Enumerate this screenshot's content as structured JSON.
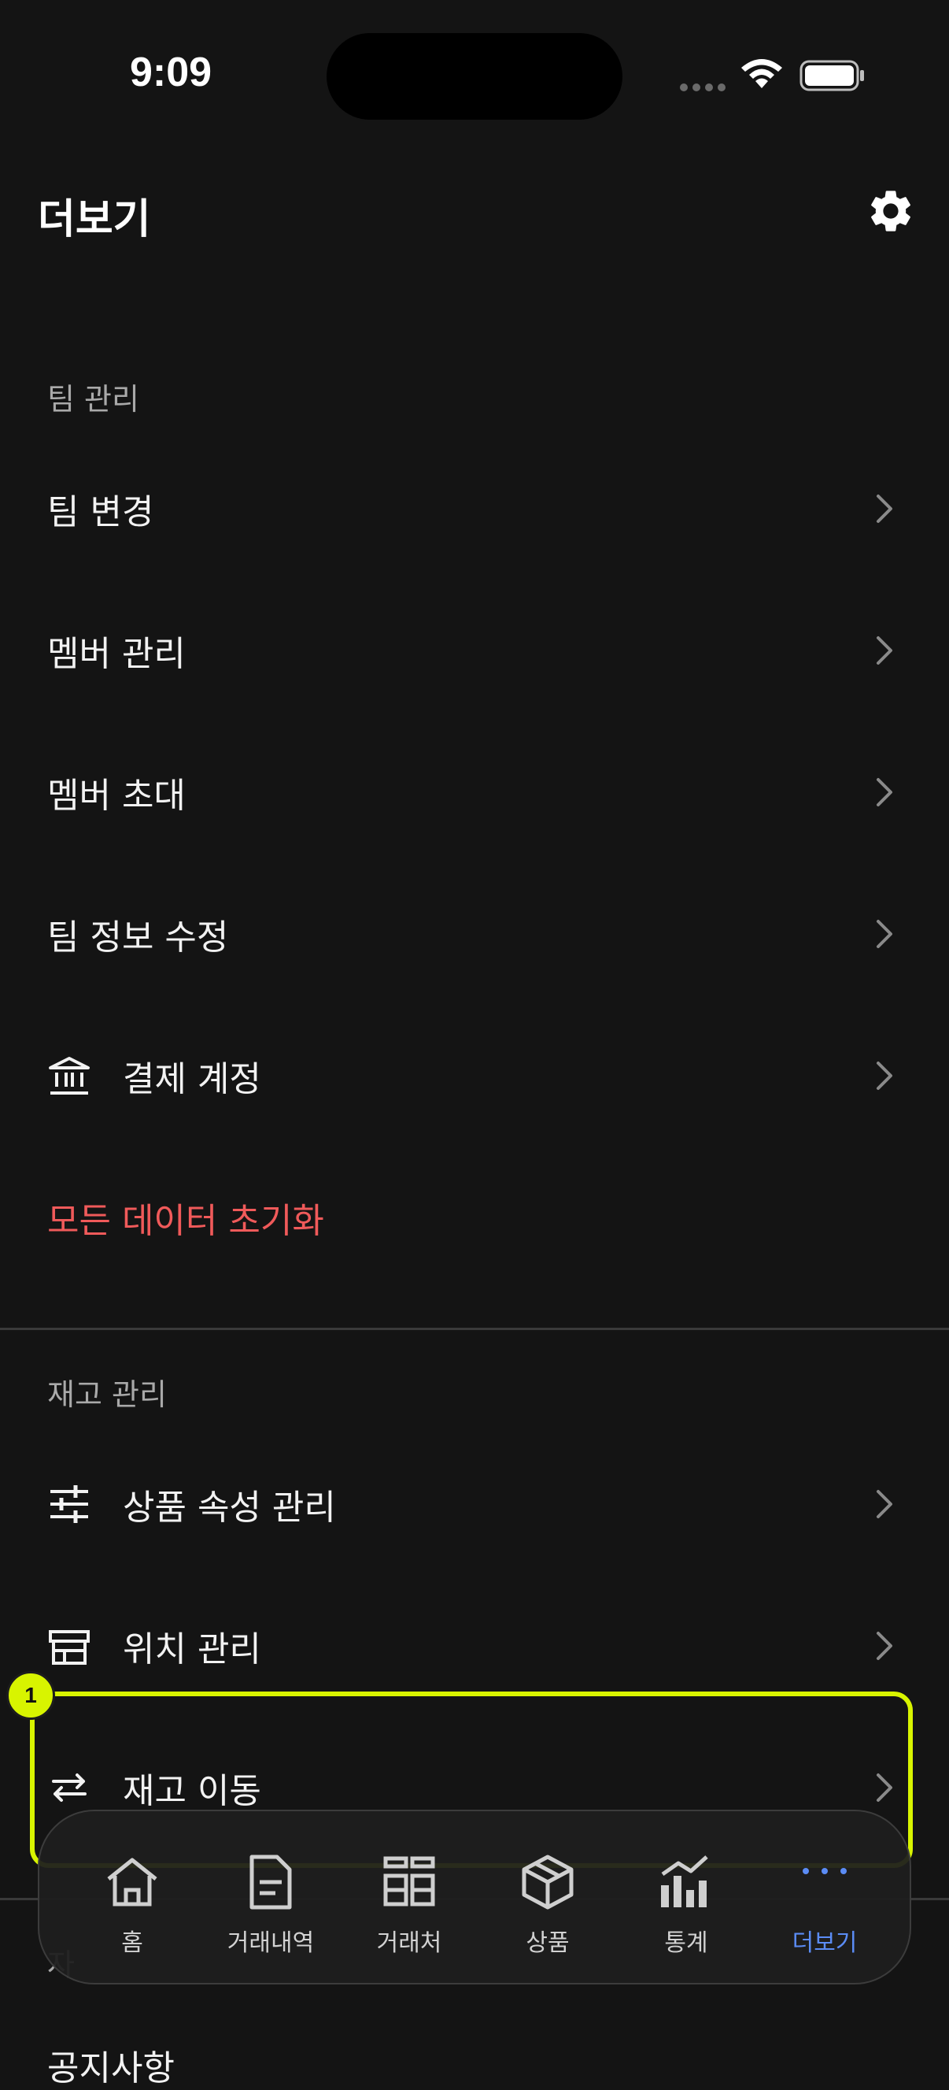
{
  "status_bar": {
    "time": "9:09"
  },
  "header": {
    "title": "더보기"
  },
  "team_section": {
    "title": "팀 관리",
    "items": [
      {
        "label": "팀 변경"
      },
      {
        "label": "멤버 관리"
      },
      {
        "label": "멤버 초대"
      },
      {
        "label": "팀 정보 수정"
      },
      {
        "label": "결제 계정",
        "icon": "bank-icon"
      },
      {
        "label": "모든 데이터 초기화",
        "style": "danger"
      }
    ]
  },
  "inventory_section": {
    "title": "재고 관리",
    "items": [
      {
        "label": "상품 속성 관리",
        "icon": "sliders-icon"
      },
      {
        "label": "위치 관리",
        "icon": "store-icon"
      },
      {
        "label": "재고 이동",
        "icon": "swap-arrows-icon"
      }
    ]
  },
  "annotation": {
    "badge": "1"
  },
  "partial": {
    "section_title_fragment": "자",
    "item_fragment": "공지사항"
  },
  "tab_bar": {
    "tabs": [
      {
        "label": "홈",
        "icon": "home-icon"
      },
      {
        "label": "거래내역",
        "icon": "document-icon"
      },
      {
        "label": "거래처",
        "icon": "grid-icon"
      },
      {
        "label": "상품",
        "icon": "box-icon"
      },
      {
        "label": "통계",
        "icon": "chart-icon"
      },
      {
        "label": "더보기",
        "icon": "more-dots-icon",
        "active": true
      }
    ]
  },
  "colors": {
    "background": "#141414",
    "danger": "#f05a5a",
    "accent": "#5b8cf5",
    "highlight": "#d8f400"
  }
}
